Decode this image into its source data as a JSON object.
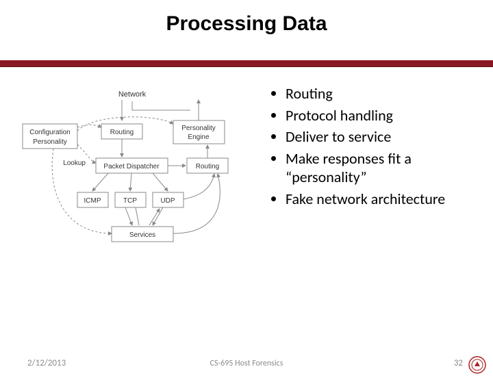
{
  "title": "Processing Data",
  "diagram": {
    "network": "Network",
    "config": "Configuration",
    "personality": "Personality",
    "routing_top": "Routing",
    "pengine": "Personality\nEngine",
    "lookup": "Lookup",
    "dispatcher": "Packet Dispatcher",
    "routing_mid": "Routing",
    "icmp": "ICMP",
    "tcp": "TCP",
    "udp": "UDP",
    "services": "Services"
  },
  "bullets": [
    "Routing",
    "Protocol handling",
    "Deliver to service",
    "Make responses fit a “personality”",
    "Fake network architecture"
  ],
  "footer": {
    "date": "2/12/2013",
    "course": "CS-695 Host Forensics",
    "page": "32"
  }
}
